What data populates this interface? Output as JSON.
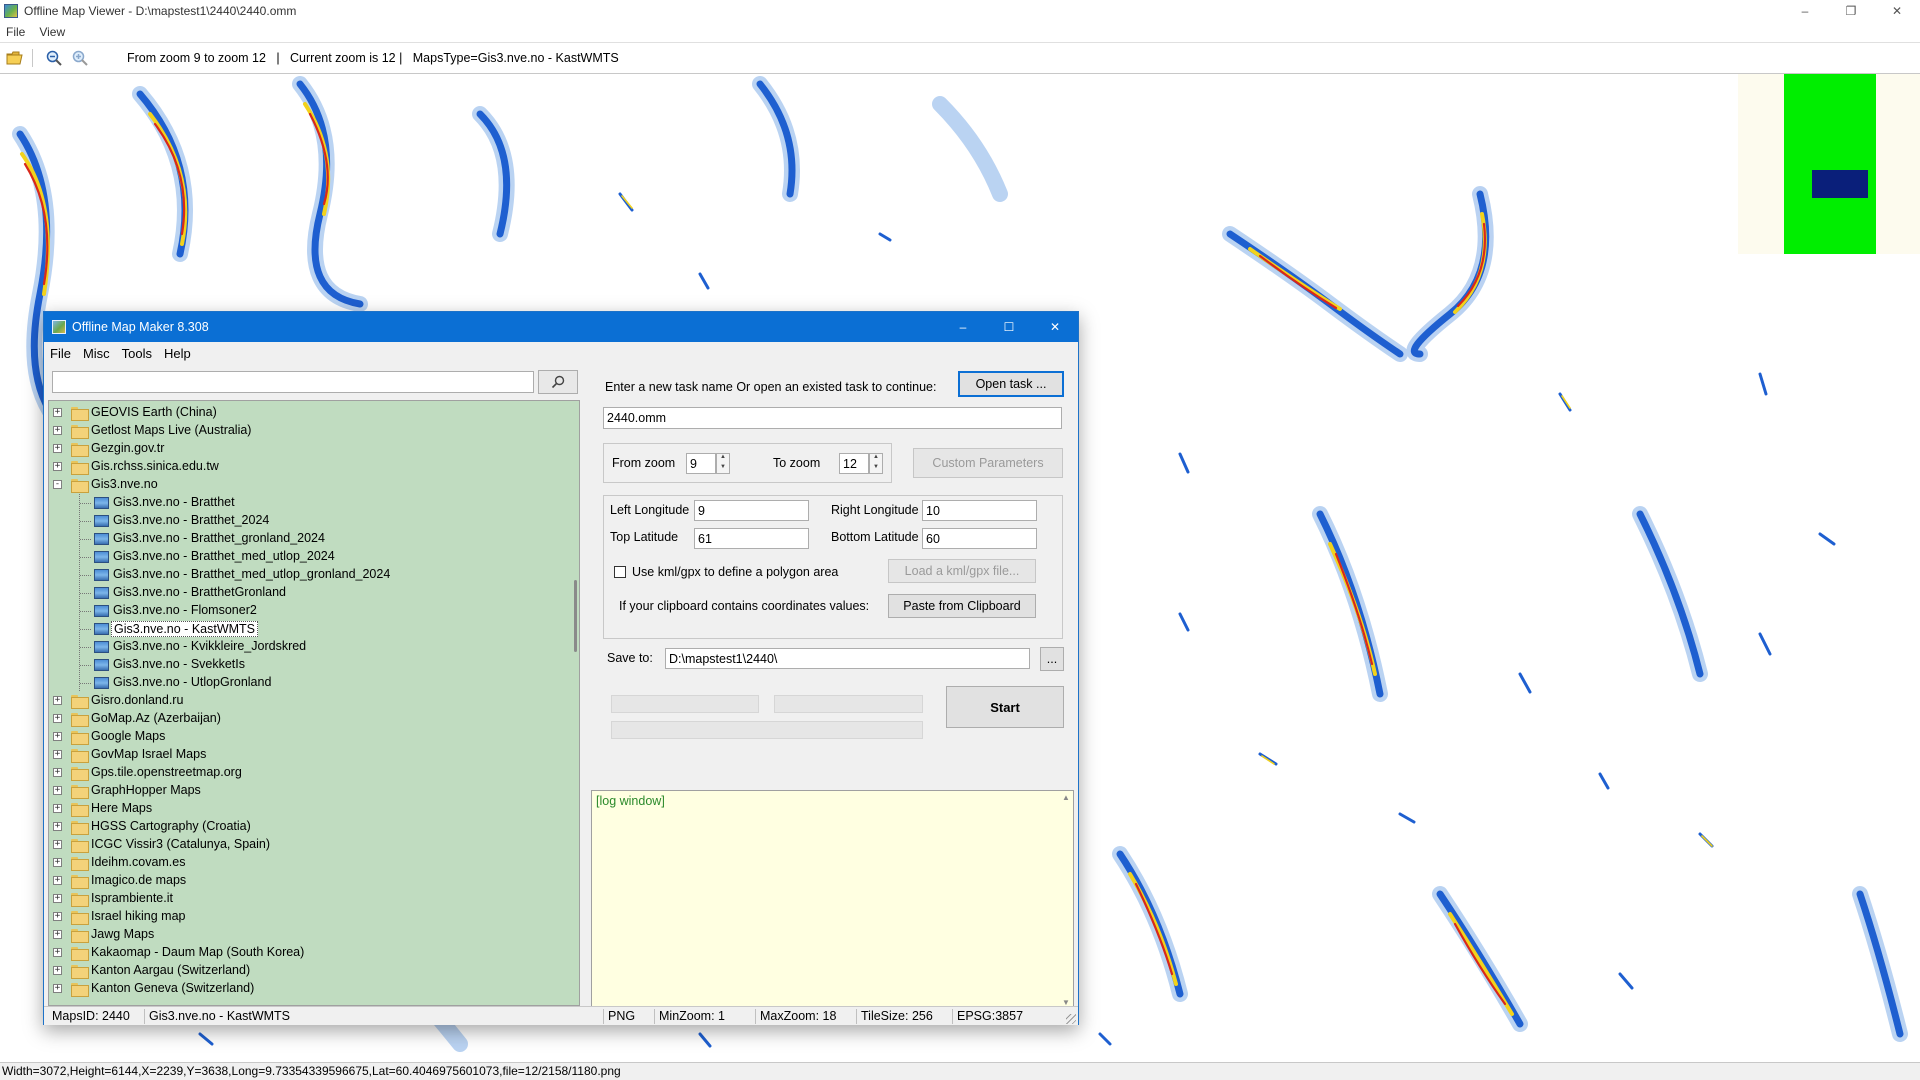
{
  "viewer": {
    "title": "Offline Map Viewer - D:\\mapstest1\\2440\\2440.omm",
    "menu": [
      "File",
      "View"
    ],
    "toolbar_info": "From zoom 9 to zoom 12   |   Current zoom is 12 |   MapsType=Gis3.nve.no - KastWMTS",
    "status": "Width=3072,Height=6144,X=2239,Y=3638,Long=9.73354339596675,Lat=60.4046975601073,file=12/2158/1180.png"
  },
  "dialog": {
    "title": "Offline Map Maker 8.308",
    "menu": [
      "File",
      "Misc",
      "Tools",
      "Help"
    ],
    "search_value": "",
    "tree": [
      {
        "label": "GEOVIS Earth (China)",
        "level": 0,
        "expanded": false
      },
      {
        "label": "Getlost Maps Live (Australia)",
        "level": 0,
        "expanded": false
      },
      {
        "label": "Gezgin.gov.tr",
        "level": 0,
        "expanded": false
      },
      {
        "label": "Gis.rchss.sinica.edu.tw",
        "level": 0,
        "expanded": false
      },
      {
        "label": "Gis3.nve.no",
        "level": 0,
        "expanded": true
      },
      {
        "label": "Gis3.nve.no - Bratthet",
        "level": 1
      },
      {
        "label": "Gis3.nve.no - Bratthet_2024",
        "level": 1
      },
      {
        "label": "Gis3.nve.no - Bratthet_gronland_2024",
        "level": 1
      },
      {
        "label": "Gis3.nve.no - Bratthet_med_utlop_2024",
        "level": 1
      },
      {
        "label": "Gis3.nve.no - Bratthet_med_utlop_gronland_2024",
        "level": 1
      },
      {
        "label": "Gis3.nve.no - BratthetGronland",
        "level": 1
      },
      {
        "label": "Gis3.nve.no - Flomsoner2",
        "level": 1
      },
      {
        "label": "Gis3.nve.no - KastWMTS",
        "level": 1,
        "selected": true
      },
      {
        "label": "Gis3.nve.no - Kvikkleire_Jordskred",
        "level": 1
      },
      {
        "label": "Gis3.nve.no - SvekketIs",
        "level": 1
      },
      {
        "label": "Gis3.nve.no - UtlopGronland",
        "level": 1
      },
      {
        "label": "Gisro.donland.ru",
        "level": 0,
        "expanded": false
      },
      {
        "label": "GoMap.Az (Azerbaijan)",
        "level": 0,
        "expanded": false
      },
      {
        "label": "Google Maps",
        "level": 0,
        "expanded": false
      },
      {
        "label": "GovMap Israel Maps",
        "level": 0,
        "expanded": false
      },
      {
        "label": "Gps.tile.openstreetmap.org",
        "level": 0,
        "expanded": false
      },
      {
        "label": "GraphHopper Maps",
        "level": 0,
        "expanded": false
      },
      {
        "label": "Here Maps",
        "level": 0,
        "expanded": false
      },
      {
        "label": "HGSS Cartography (Croatia)",
        "level": 0,
        "expanded": false
      },
      {
        "label": "ICGC Vissir3 (Catalunya, Spain)",
        "level": 0,
        "expanded": false
      },
      {
        "label": "Ideihm.covam.es",
        "level": 0,
        "expanded": false
      },
      {
        "label": "Imagico.de maps",
        "level": 0,
        "expanded": false
      },
      {
        "label": "Isprambiente.it",
        "level": 0,
        "expanded": false
      },
      {
        "label": "Israel hiking map",
        "level": 0,
        "expanded": false
      },
      {
        "label": "Jawg Maps",
        "level": 0,
        "expanded": false
      },
      {
        "label": "Kakaomap - Daum Map (South Korea)",
        "level": 0,
        "expanded": false
      },
      {
        "label": "Kanton Aargau (Switzerland)",
        "level": 0,
        "expanded": false
      },
      {
        "label": "Kanton Geneva (Switzerland)",
        "level": 0,
        "expanded": false
      }
    ],
    "task_prompt": "Enter a new task name Or open an existed task to continue:",
    "open_task_label": "Open task ...",
    "task_name": "2440.omm",
    "from_zoom_label": "From zoom",
    "from_zoom": "9",
    "to_zoom_label": "To zoom",
    "to_zoom": "12",
    "custom_params_label": "Custom Parameters",
    "left_lon_label": "Left Longitude",
    "left_lon": "9",
    "right_lon_label": "Right Longitude",
    "right_lon": "10",
    "top_lat_label": "Top Latitude",
    "top_lat": "61",
    "bottom_lat_label": "Bottom Latitude",
    "bottom_lat": "60",
    "kml_label": "Use kml/gpx to define a polygon area",
    "load_kml_label": "Load a kml/gpx file...",
    "clipboard_label": "If your clipboard contains coordinates values:",
    "paste_label": "Paste from Clipboard",
    "save_to_label": "Save to:",
    "save_to": "D:\\mapstest1\\2440\\",
    "browse_label": "...",
    "start_label": "Start",
    "log_text": "[log window]",
    "status": {
      "maps_id": "MapsID: 2440",
      "maps_name": "Gis3.nve.no - KastWMTS",
      "format": "PNG",
      "min_zoom": "MinZoom: 1",
      "max_zoom": "MaxZoom: 18",
      "tile_size": "TileSize: 256",
      "epsg": "EPSG:3857"
    }
  },
  "colors": {
    "title_blue": "#0b6fd4",
    "tree_bg": "#c0dcc0",
    "log_bg": "#ffffe1",
    "log_text": "#2b8a2b",
    "overview_green": "#00ee00",
    "overview_navy": "#0a1f7a"
  },
  "icons": [
    "app-icon",
    "open-folder-icon",
    "zoom-out-icon",
    "zoom-in-icon",
    "search-icon",
    "folder-icon",
    "map-icon",
    "minimize-icon",
    "maximize-icon",
    "close-icon"
  ]
}
